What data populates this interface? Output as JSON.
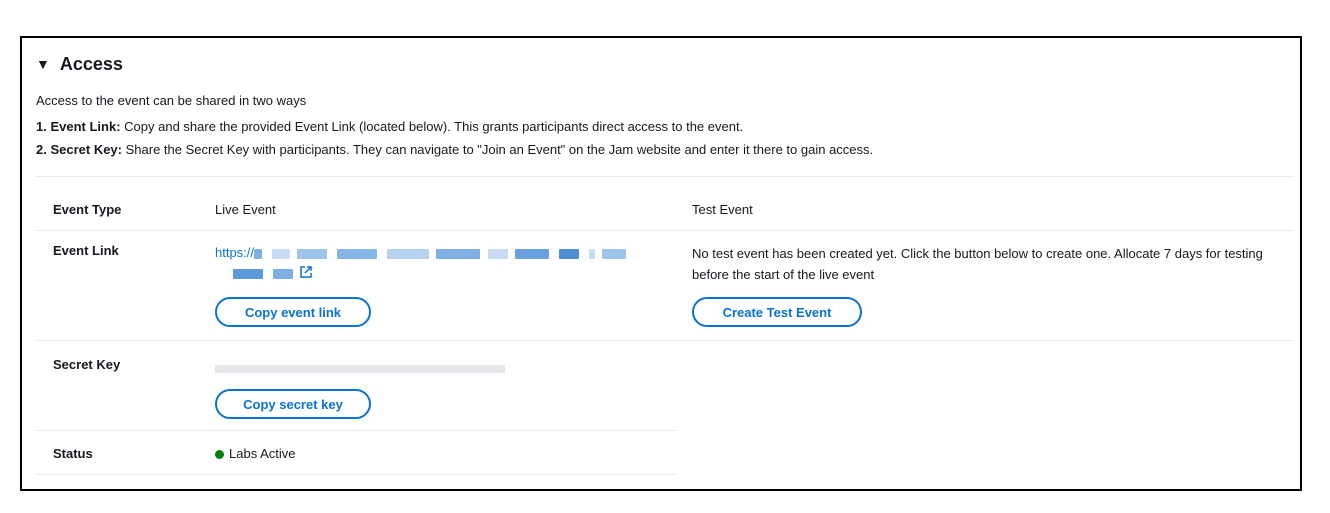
{
  "section": {
    "title": "Access",
    "caret": "▼",
    "intro": "Access to the event can be shared in two ways",
    "item1_label": "1. Event Link:",
    "item1_text": " Copy and share the provided Event Link (located below). This grants participants direct access to the event.",
    "item2_label": "2. Secret Key:",
    "item2_text": " Share the Secret Key with participants. They can navigate to \"Join an Event\" on the Jam website and enter it there to gain access."
  },
  "table": {
    "event_type_label": "Event Type",
    "live_event_header": "Live Event",
    "test_event_header": "Test Event",
    "event_link_label": "Event Link",
    "event_link_prefix": "https://",
    "copy_event_link": "Copy event link",
    "test_event_message": "No test event has been created yet. Click the button below to create one. Allocate 7 days for testing before the start of the live event",
    "create_test_event": "Create Test Event",
    "secret_key_label": "Secret Key",
    "copy_secret_key": "Copy secret key",
    "status_label": "Status",
    "status_value": "Labs Active"
  },
  "colors": {
    "link": "#0972d3",
    "status_green": "#037f0c",
    "border": "#000000",
    "divider": "#e9ebed"
  },
  "icons": {
    "caret": "caret-down-icon",
    "external": "external-link-icon",
    "status": "status-success-icon"
  }
}
